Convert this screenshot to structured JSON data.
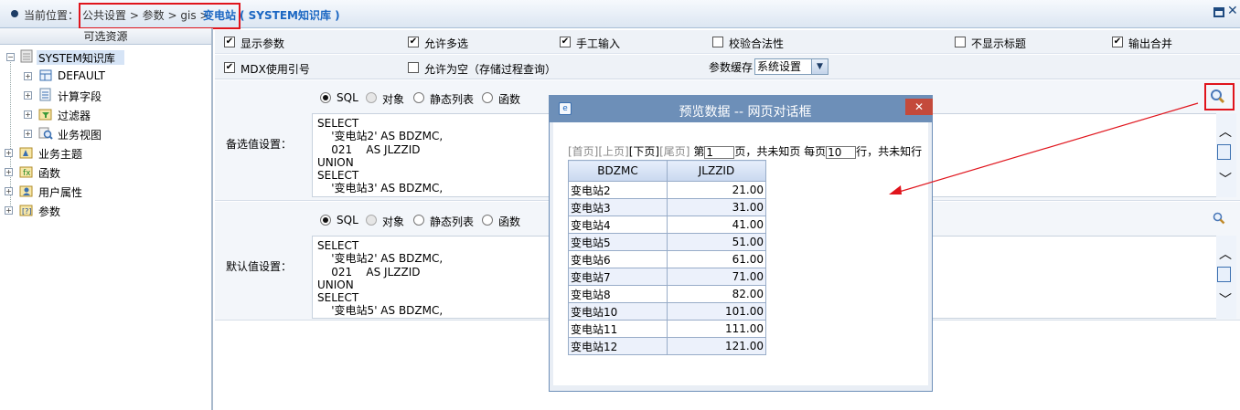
{
  "breadcrumb": {
    "label": "当前位置：",
    "path": "公共设置 > 参数 > gis >",
    "current": "变电站",
    "sub": "( SYSTEM知识库 )"
  },
  "left": {
    "title": "可选资源",
    "tree": [
      {
        "label": "SYSTEM知识库",
        "icon": "database-icon"
      },
      {
        "label": "DEFAULT",
        "icon": "table-icon"
      },
      {
        "label": "计算字段",
        "icon": "calc-field-icon"
      },
      {
        "label": "过滤器",
        "icon": "filter-icon"
      },
      {
        "label": "业务视图",
        "icon": "view-icon"
      },
      {
        "label": "业务主题",
        "icon": "topic-icon"
      },
      {
        "label": "函数",
        "icon": "function-icon"
      },
      {
        "label": "用户属性",
        "icon": "user-attr-icon"
      },
      {
        "label": "参数",
        "icon": "param-icon"
      }
    ]
  },
  "options": {
    "show_params": "显示参数",
    "allow_multi": "允许多选",
    "manual_input": "手工输入",
    "validate": "校验合法性",
    "hide_title": "不显示标题",
    "output_merge": "输出合并",
    "mdx_quote": "MDX使用引号",
    "allow_empty": "允许为空（存储过程查询）",
    "cache_label": "参数缓存",
    "cache_value": "系统设置"
  },
  "sources": {
    "sql": "SQL",
    "object": "对象",
    "static_list": "静态列表",
    "function": "函数"
  },
  "candidate": {
    "label": "备选值设置：",
    "lines": [
      "SELECT",
      "    '变电站2' AS BDZMC,",
      "    021    AS JLZZID",
      "UNION",
      "SELECT",
      "    '变电站3' AS BDZMC,"
    ]
  },
  "default_val": {
    "label": "默认值设置：",
    "lines": [
      "SELECT",
      "    '变电站2' AS BDZMC,",
      "    021    AS JLZZID",
      "UNION",
      "SELECT",
      "    '变电站5' AS BDZMC,"
    ]
  },
  "dialog": {
    "title": "预览数据 -- 网页对话框",
    "close": "✕",
    "pager": {
      "first": "[首页]",
      "prev": "[上页]",
      "next": "[下页]",
      "last": "[尾页]",
      "page_prefix": "第",
      "page_value": "1",
      "page_suffix": "页，共未知页 每页",
      "size_value": "10",
      "size_suffix": "行，共未知行"
    },
    "columns": [
      "BDZMC",
      "JLZZID"
    ],
    "rows": [
      [
        "变电站2",
        "21.00"
      ],
      [
        "变电站3",
        "31.00"
      ],
      [
        "变电站4",
        "41.00"
      ],
      [
        "变电站5",
        "51.00"
      ],
      [
        "变电站6",
        "61.00"
      ],
      [
        "变电站7",
        "71.00"
      ],
      [
        "变电站8",
        "82.00"
      ],
      [
        "变电站10",
        "101.00"
      ],
      [
        "变电站11",
        "111.00"
      ],
      [
        "变电站12",
        "121.00"
      ]
    ]
  },
  "colors": {
    "accent": "#1a66c2",
    "highlight": "#e0141c",
    "dialog_title": "#6d8fb8"
  }
}
